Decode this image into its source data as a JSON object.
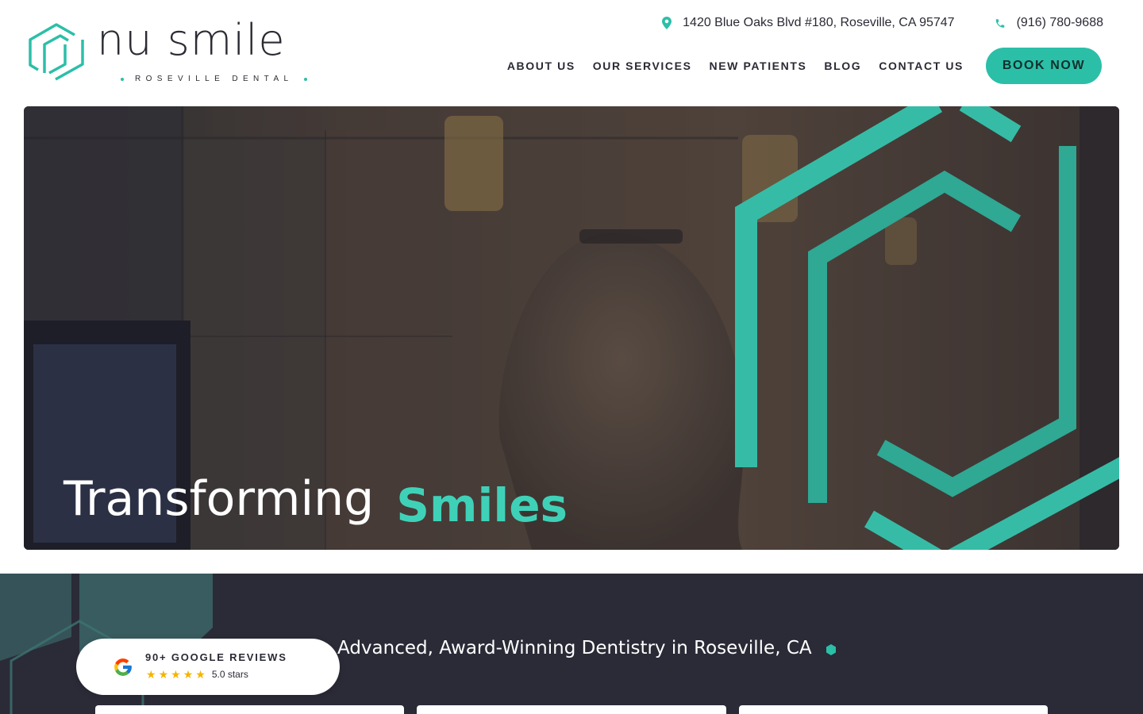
{
  "brand": {
    "name": "nu smile",
    "subtitle": "ROSEVILLE DENTAL",
    "accent_color": "#2bbfa8",
    "dark_color": "#2a2b37"
  },
  "topbar": {
    "address": "1420 Blue Oaks Blvd #180, Roseville, CA 95747",
    "address_icon": "map-pin-icon",
    "phone": "(916) 780-9688",
    "phone_icon": "phone-icon"
  },
  "nav": {
    "items": [
      {
        "label": "ABOUT US"
      },
      {
        "label": "OUR SERVICES"
      },
      {
        "label": "NEW PATIENTS"
      },
      {
        "label": "BLOG"
      },
      {
        "label": "CONTACT US"
      }
    ],
    "cta": "BOOK NOW"
  },
  "hero": {
    "title_part1": "Transforming",
    "title_part2": "Smiles"
  },
  "reviews": {
    "title": "90+ GOOGLE REVIEWS",
    "rating_text": "5.0 stars",
    "stars": 5,
    "icon": "google-icon"
  },
  "section": {
    "tagline": "Advanced, Award-Winning Dentistry in Roseville, CA"
  }
}
